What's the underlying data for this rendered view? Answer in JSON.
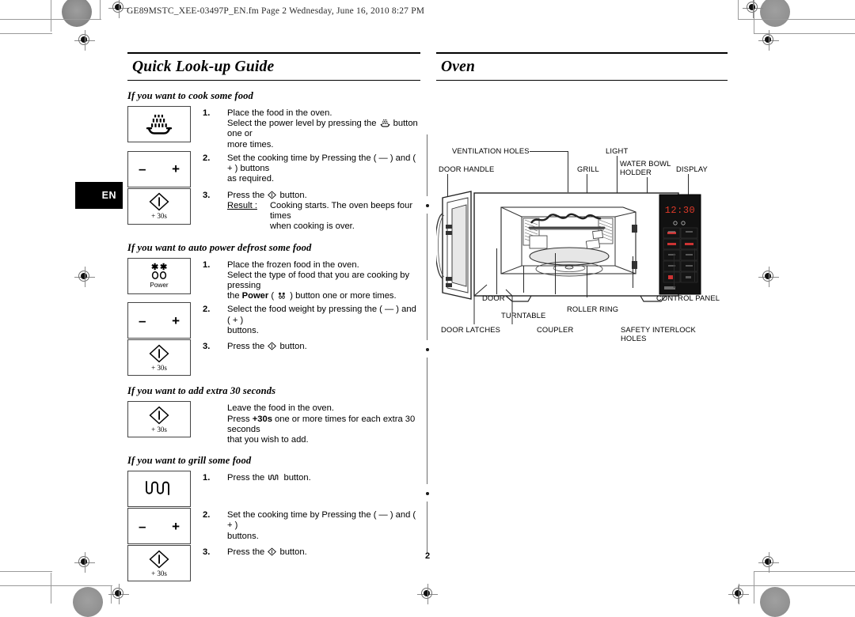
{
  "document": {
    "slug": "GE89MSTC_XEE-03497P_EN.fm  Page 2  Wednesday, June 16, 2010  8:27 PM",
    "page_number": "2",
    "language_tab": "EN"
  },
  "left_column": {
    "title": "Quick Look-up Guide",
    "sections": [
      {
        "heading": "If you want to cook some food",
        "steps": [
          {
            "number": "1.",
            "icon": "microwave-button-icon",
            "icon_caption": "",
            "lines": [
              "Place the food in the oven.",
              "Select the power level by pressing the   button one or",
              "more times."
            ]
          },
          {
            "number": "2.",
            "icon": "minus-plus-button-icon",
            "icon_caption": "",
            "lines": [
              "Set the cooking time by Pressing the ( — ) and ( + ) buttons",
              "as required."
            ]
          },
          {
            "number": "3.",
            "icon": "start-button-icon",
            "icon_caption": "+ 30s",
            "lines": [
              "Press the  button."
            ],
            "result_label": "Result :",
            "result_lines": [
              "Cooking starts. The oven beeps four times",
              "when cooking is over."
            ]
          }
        ]
      },
      {
        "heading": "If you want to auto power defrost some food",
        "steps": [
          {
            "number": "1.",
            "icon": "power-defrost-button-icon",
            "icon_caption": "Power",
            "lines": [
              "Place the frozen food in the oven.",
              "Select the type of food that you are cooking by pressing",
              "the Power ( ) button one or more times."
            ]
          },
          {
            "number": "2.",
            "icon": "minus-plus-button-icon",
            "icon_caption": "",
            "lines": [
              "Select the food weight by pressing the ( — ) and ( + )",
              "buttons."
            ]
          },
          {
            "number": "3.",
            "icon": "start-button-icon",
            "icon_caption": "+ 30s",
            "lines": [
              "Press the  button."
            ]
          }
        ]
      },
      {
        "heading": "If you want to add extra 30 seconds",
        "steps": [
          {
            "number": "",
            "icon": "start-button-icon",
            "icon_caption": "+ 30s",
            "lines": [
              "Leave the food in the oven.",
              "Press +30s one or more times for each extra 30 seconds",
              "that you wish to add."
            ]
          }
        ]
      },
      {
        "heading": "If you want to grill some food",
        "steps": [
          {
            "number": "1.",
            "icon": "grill-button-icon",
            "icon_caption": "",
            "lines": [
              "Press the  button."
            ]
          },
          {
            "number": "2.",
            "icon": "minus-plus-button-icon",
            "icon_caption": "",
            "lines": [
              "Set the cooking time by Pressing the ( — ) and ( + )",
              "buttons."
            ]
          },
          {
            "number": "3.",
            "icon": "start-button-icon",
            "icon_caption": "+ 30s",
            "lines": [
              "Press the  button."
            ]
          }
        ]
      }
    ],
    "inline_text": {
      "minus_plus_buttons_1": "Set the cooking time by Pressing the (",
      "and": ") and (",
      "buttons_tail": ") buttons"
    }
  },
  "right_column": {
    "title": "Oven",
    "diagram": {
      "name": "microwave-oven-cutaway-diagram",
      "display_value": "12:30",
      "display_color": "#e03a2a",
      "control_panel_color": "#111111",
      "labels": [
        "VENTILATION HOLES",
        "DOOR HANDLE",
        "LIGHT",
        "GRILL",
        "WATER BOWL",
        "HOLDER",
        "DISPLAY",
        "DOOR",
        "TURNTABLE",
        "ROLLER RING",
        "CONTROL PANEL",
        "DOOR LATCHES",
        "COUPLER",
        "SAFETY INTERLOCK",
        "HOLES"
      ]
    }
  }
}
